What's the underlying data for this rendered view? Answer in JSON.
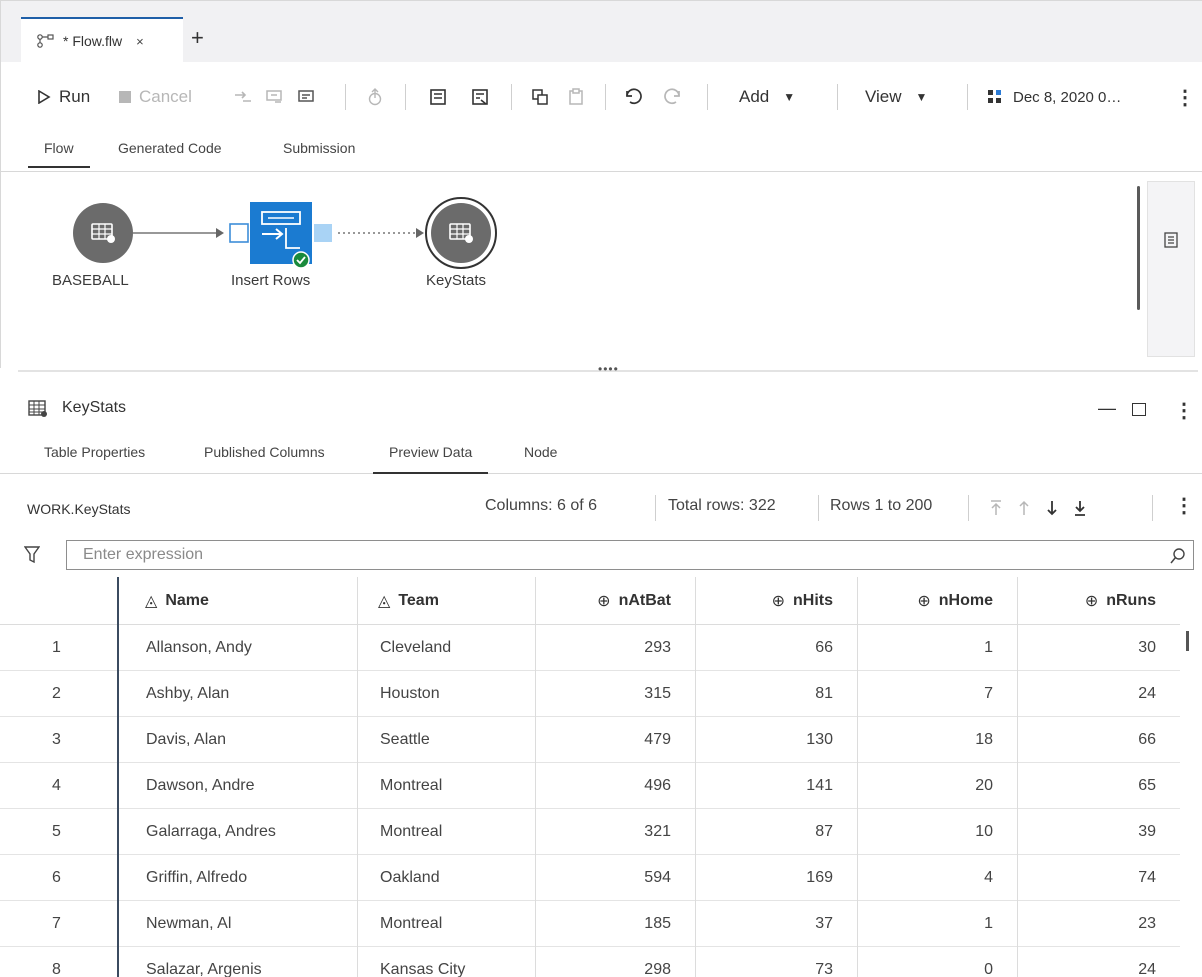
{
  "tab": {
    "title": "* Flow.flw",
    "close": "×",
    "new": "+"
  },
  "toolbar": {
    "run_label": "Run",
    "cancel_label": "Cancel",
    "add_label": "Add",
    "view_label": "View",
    "date_label": "Dec 8, 2020 0…",
    "more": "⋮"
  },
  "subtabs": [
    "Flow",
    "Generated Code",
    "Submission"
  ],
  "flow": {
    "nodes": [
      {
        "label": "BASEBALL"
      },
      {
        "label": "Insert Rows"
      },
      {
        "label": "KeyStats"
      }
    ]
  },
  "details": {
    "title": "KeyStats",
    "tabs": [
      "Table Properties",
      "Published Columns",
      "Preview Data",
      "Node"
    ],
    "library": "WORK.KeyStats",
    "columns_info": "Columns: 6 of 6",
    "total_rows": "Total rows: 322",
    "rows_range": "Rows 1 to 200",
    "filter_placeholder": "Enter expression"
  },
  "table": {
    "columns": [
      {
        "name": "Name",
        "type": "char"
      },
      {
        "name": "Team",
        "type": "char"
      },
      {
        "name": "nAtBat",
        "type": "num"
      },
      {
        "name": "nHits",
        "type": "num"
      },
      {
        "name": "nHome",
        "type": "num"
      },
      {
        "name": "nRuns",
        "type": "num"
      }
    ],
    "rows": [
      [
        "1",
        "Allanson, Andy",
        "Cleveland",
        "293",
        "66",
        "1",
        "30"
      ],
      [
        "2",
        "Ashby, Alan",
        "Houston",
        "315",
        "81",
        "7",
        "24"
      ],
      [
        "3",
        "Davis, Alan",
        "Seattle",
        "479",
        "130",
        "18",
        "66"
      ],
      [
        "4",
        "Dawson, Andre",
        "Montreal",
        "496",
        "141",
        "20",
        "65"
      ],
      [
        "5",
        "Galarraga, Andres",
        "Montreal",
        "321",
        "87",
        "10",
        "39"
      ],
      [
        "6",
        "Griffin, Alfredo",
        "Oakland",
        "594",
        "169",
        "4",
        "74"
      ],
      [
        "7",
        "Newman, Al",
        "Montreal",
        "185",
        "37",
        "1",
        "23"
      ],
      [
        "8",
        "Salazar, Argenis",
        "Kansas City",
        "298",
        "73",
        "0",
        "24"
      ]
    ]
  }
}
